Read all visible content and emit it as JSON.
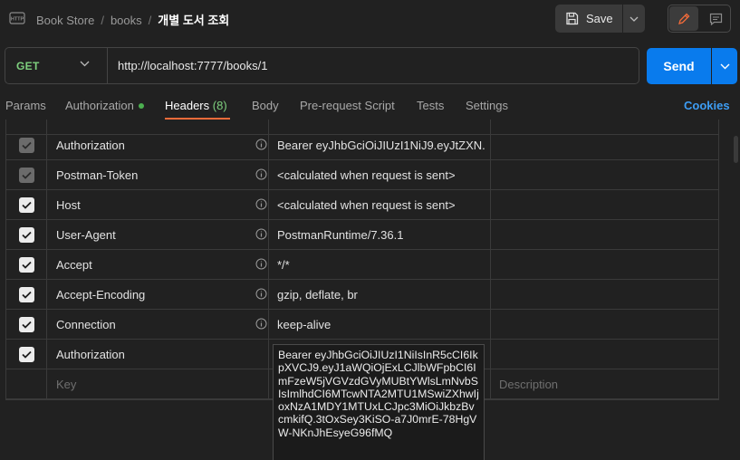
{
  "breadcrumb": {
    "collection": "Book Store",
    "folder": "books",
    "current": "개별 도서 조회",
    "separator": "/"
  },
  "toolbar": {
    "save_label": "Save"
  },
  "request": {
    "method": "GET",
    "url": "http://localhost:7777/books/1",
    "send_label": "Send"
  },
  "tabs": [
    {
      "label": "Params"
    },
    {
      "label": "Authorization"
    },
    {
      "label": "Headers",
      "count": "(8)"
    },
    {
      "label": "Body"
    },
    {
      "label": "Pre-request Script"
    },
    {
      "label": "Tests"
    },
    {
      "label": "Settings"
    }
  ],
  "cookies_label": "Cookies",
  "headers": [
    {
      "key": "Authorization",
      "value": "Bearer eyJhbGciOiJIUzI1NiJ9.eyJtZXN...",
      "checked": true,
      "auto": true
    },
    {
      "key": "Postman-Token",
      "value": "<calculated when request is sent>",
      "checked": true,
      "auto": true
    },
    {
      "key": "Host",
      "value": "<calculated when request is sent>",
      "checked": true,
      "auto": false
    },
    {
      "key": "User-Agent",
      "value": "PostmanRuntime/7.36.1",
      "checked": true,
      "auto": false
    },
    {
      "key": "Accept",
      "value": "*/*",
      "checked": true,
      "auto": false
    },
    {
      "key": "Accept-Encoding",
      "value": "gzip, deflate, br",
      "checked": true,
      "auto": false
    },
    {
      "key": "Connection",
      "value": "keep-alive",
      "checked": true,
      "auto": false
    },
    {
      "key": "Authorization",
      "value": "",
      "checked": true,
      "auto": false
    }
  ],
  "new_row": {
    "key_placeholder": "Key",
    "description_placeholder": "Description"
  },
  "value_popup": "Bearer eyJhbGciOiJIUzI1NiIsInR5cCI6IkpXVCJ9.eyJ1aWQiOjExLCJlbWFpbCI6ImFzeW5jVGVzdGVyMUBtYWlsLmNvbSIsImlhdCI6MTcwNTA2MTU1MSwiZXhwIjoxNzA1MDY1MTUxLCJpc3MiOiJkbzBvcmkifQ.3tOxSey3KiSO-a7J0mrE-78HgVW-NKnJhEsyeG96fMQ",
  "colors": {
    "accent": "#097bed",
    "method_get": "#7ed07e",
    "tab_underline": "#f26b3a",
    "link": "#3d9df4"
  }
}
